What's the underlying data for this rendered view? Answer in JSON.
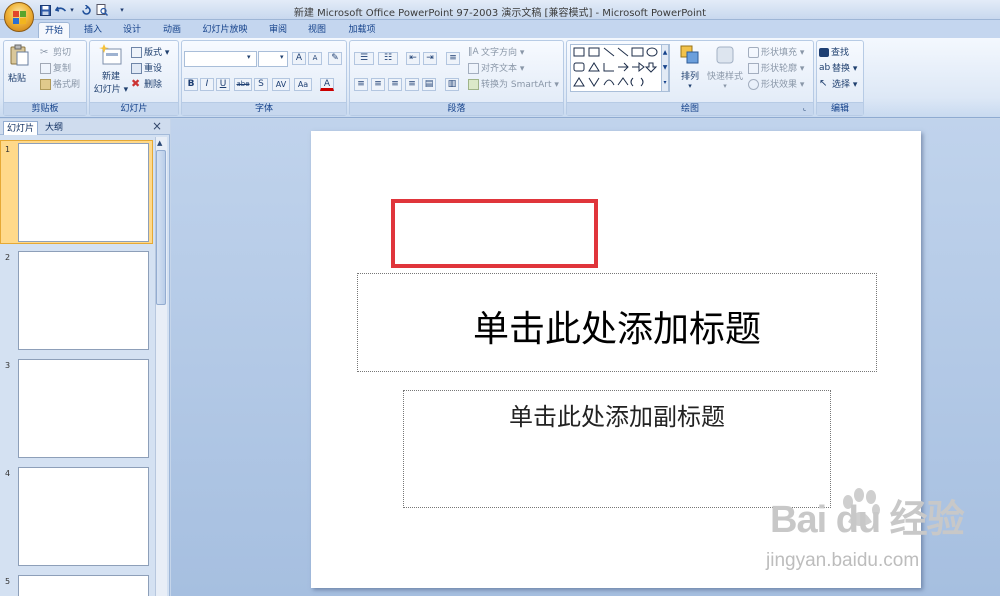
{
  "window": {
    "title": "新建 Microsoft Office PowerPoint 97-2003 演示文稿 [兼容模式] - Microsoft PowerPoint"
  },
  "quick_access": [
    "save-icon",
    "undo-icon",
    "redo-icon",
    "print-preview-icon",
    "customize-dropdown-icon"
  ],
  "tabs": [
    {
      "label": "开始",
      "active": true
    },
    {
      "label": "插入"
    },
    {
      "label": "设计"
    },
    {
      "label": "动画"
    },
    {
      "label": "幻灯片放映"
    },
    {
      "label": "审阅"
    },
    {
      "label": "视图"
    },
    {
      "label": "加载项"
    }
  ],
  "ribbon": {
    "clipboard": {
      "label": "剪贴板",
      "paste": "粘贴",
      "cut": "剪切",
      "copy": "复制",
      "format_painter": "格式刷"
    },
    "slides": {
      "label": "幻灯片",
      "new_slide": "新建",
      "new_slide_2": "幻灯片",
      "layout": "版式",
      "reset": "重设",
      "delete": "删除"
    },
    "font": {
      "label": "字体",
      "grow": "A",
      "shrink": "A",
      "bold": "B",
      "italic": "I",
      "underline": "U",
      "strike": "abe",
      "shadow": "S",
      "spacing": "AV",
      "case": "Aa",
      "color": "A"
    },
    "paragraph": {
      "label": "段落",
      "text_direction": "文字方向",
      "align_text": "对齐文本",
      "convert_smartart": "转换为 SmartArt"
    },
    "drawing": {
      "label": "绘图",
      "arrange": "排列",
      "quick_styles": "快速样式",
      "shape_fill": "形状填充",
      "shape_outline": "形状轮廓",
      "shape_effects": "形状效果"
    },
    "editing": {
      "label": "编辑",
      "find": "查找",
      "replace": "替换",
      "select": "选择"
    }
  },
  "left_panel": {
    "tab_slides": "幻灯片",
    "tab_outline": "大纲",
    "close": "×",
    "thumbnails": [
      "1",
      "2",
      "3",
      "4",
      "5"
    ]
  },
  "slide": {
    "title_placeholder": "单击此处添加标题",
    "subtitle_placeholder": "单击此处添加副标题"
  },
  "watermark": {
    "logo": "Bai du 经验",
    "url": "jingyan.baidu.com"
  },
  "colors": {
    "highlight_box": "#e0353b",
    "selected_thumb": "#ffd98a"
  }
}
